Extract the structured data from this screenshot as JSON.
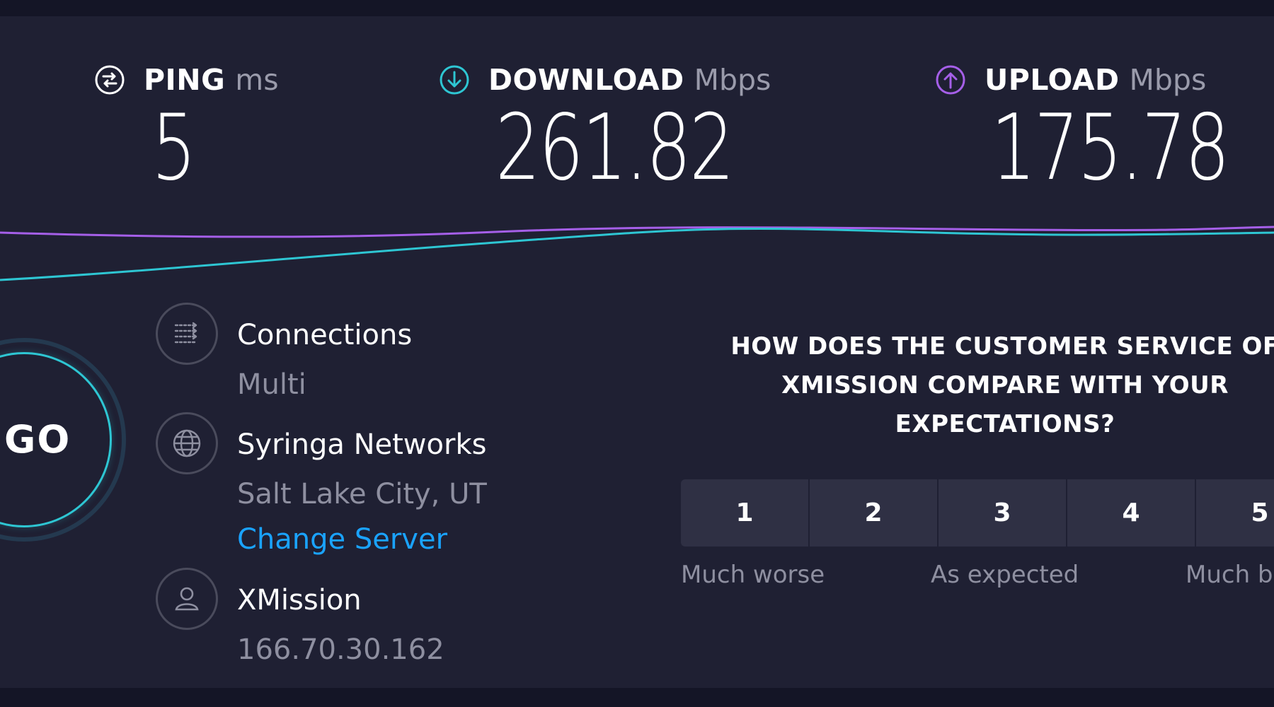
{
  "metrics": {
    "ping": {
      "title": "PING",
      "unit": "ms",
      "value": "5",
      "icon": "ping-icon",
      "color": "#ffffff"
    },
    "download": {
      "title": "DOWNLOAD",
      "unit": "Mbps",
      "value": "261.82",
      "icon": "download-arrow-icon",
      "color": "#2ec6d3"
    },
    "upload": {
      "title": "UPLOAD",
      "unit": "Mbps",
      "value": "175.78",
      "icon": "upload-arrow-icon",
      "color": "#a55fe8"
    }
  },
  "graph": {
    "download_color": "#2ec6d3",
    "upload_color": "#a55fe8"
  },
  "go_button": {
    "label": "GO",
    "color": "#2ec6d3"
  },
  "connections": {
    "icon": "connections-icon",
    "title": "Connections",
    "value": "Multi"
  },
  "server": {
    "icon": "globe-icon",
    "name": "Syringa Networks",
    "location": "Salt Lake City, UT",
    "change_link": "Change Server"
  },
  "provider": {
    "icon": "user-icon",
    "name": "XMission",
    "ip": "166.70.30.162"
  },
  "survey": {
    "question": "HOW DOES THE CUSTOMER SERVICE OF XMISSION COMPARE WITH YOUR EXPECTATIONS?",
    "ratings": [
      "1",
      "2",
      "3",
      "4",
      "5"
    ],
    "labels": {
      "low": "Much worse",
      "mid": "As expected",
      "high": "Much better"
    }
  }
}
